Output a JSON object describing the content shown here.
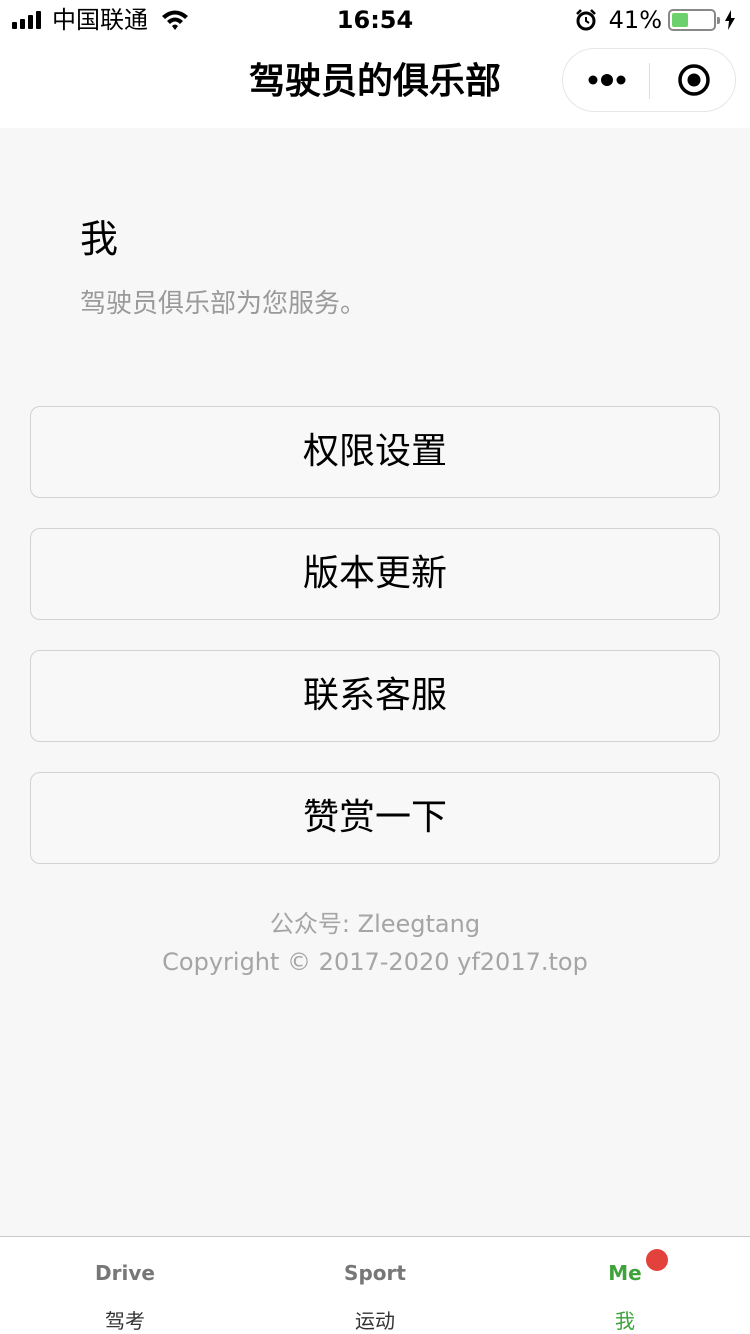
{
  "status_bar": {
    "carrier": "中国联通",
    "time": "16:54",
    "battery_percent_text": "41%",
    "battery_level": 0.41,
    "icons": [
      "signal-icon",
      "wifi-icon",
      "alarm-icon",
      "battery-icon",
      "charging-icon"
    ]
  },
  "nav": {
    "title": "驾驶员的俱乐部",
    "more_icon": "more-dots-icon",
    "close_icon": "target-close-icon"
  },
  "profile": {
    "title": "我",
    "subtitle": "驾驶员俱乐部为您服务。"
  },
  "menu": [
    {
      "label": "权限设置"
    },
    {
      "label": "版本更新"
    },
    {
      "label": "联系客服"
    },
    {
      "label": "赞赏一下"
    }
  ],
  "footer": {
    "line1": "公众号: Zleegtang",
    "line2": "Copyright © 2017-2020 yf2017.top"
  },
  "tabs": [
    {
      "icon_text": "Drive",
      "label": "驾考",
      "active": false
    },
    {
      "icon_text": "Sport",
      "label": "运动",
      "active": false
    },
    {
      "icon_text": "Me",
      "label": "我",
      "active": true,
      "badge": true
    }
  ],
  "colors": {
    "accent": "#3fa23a",
    "badge": "#e3413c",
    "background": "#f7f7f7",
    "battery": "#6cd06c"
  }
}
